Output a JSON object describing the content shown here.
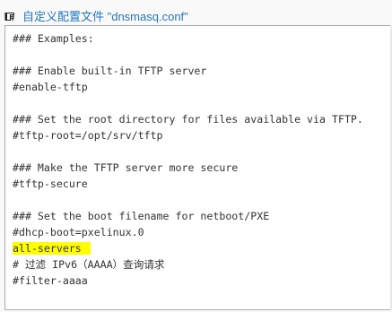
{
  "header": {
    "icon": "pointing-hand-icon",
    "title": "自定义配置文件 \"dnsmasq.conf\""
  },
  "editor": {
    "highlight_color": "#ffff00",
    "lines": [
      {
        "text": "### Examples:",
        "highlight": false
      },
      {
        "text": "",
        "highlight": false
      },
      {
        "text": "### Enable built-in TFTP server",
        "highlight": false
      },
      {
        "text": "#enable-tftp",
        "highlight": false
      },
      {
        "text": "",
        "highlight": false
      },
      {
        "text": "### Set the root directory for files available via TFTP.",
        "highlight": false
      },
      {
        "text": "#tftp-root=/opt/srv/tftp",
        "highlight": false
      },
      {
        "text": "",
        "highlight": false
      },
      {
        "text": "### Make the TFTP server more secure",
        "highlight": false
      },
      {
        "text": "#tftp-secure",
        "highlight": false
      },
      {
        "text": "",
        "highlight": false
      },
      {
        "text": "### Set the boot filename for netboot/PXE",
        "highlight": false
      },
      {
        "text": "#dhcp-boot=pxelinux.0",
        "highlight": false
      },
      {
        "text": "all-servers",
        "highlight": true
      },
      {
        "text": "# 过滤 IPv6（AAAA）查询请求",
        "highlight": false
      },
      {
        "text": "#filter-aaaa",
        "highlight": false
      }
    ]
  }
}
